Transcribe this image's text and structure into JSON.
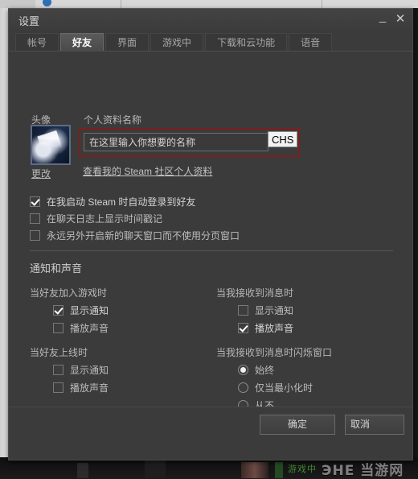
{
  "window": {
    "title": "设置",
    "minimize_label": "_",
    "close_label": "✕"
  },
  "tabs": [
    {
      "label": "帐号",
      "active": false
    },
    {
      "label": "好友",
      "active": true
    },
    {
      "label": "界面",
      "active": false
    },
    {
      "label": "游戏中",
      "active": false
    },
    {
      "label": "下载和云功能",
      "active": false
    },
    {
      "label": "语音",
      "active": false
    }
  ],
  "avatar": {
    "label": "头像",
    "change_label": "更改"
  },
  "profile": {
    "label": "个人资料名称",
    "name_value": "在这里输入你想要的名称",
    "name_placeholder": "在这里输入你想要的名称",
    "ime_indicator": "CHS",
    "link_label": "查看我的 Steam 社区个人资料",
    "highlight_color": "#7d1f1f"
  },
  "general_options": [
    {
      "label": "在我启动 Steam 时自动登录到好友",
      "checked": true
    },
    {
      "label": "在聊天日志上显示时间戳记",
      "checked": false
    },
    {
      "label": "永远另外开启新的聊天窗口而不使用分页窗口",
      "checked": false
    }
  ],
  "notifications": {
    "header": "通知和声音",
    "groups": [
      {
        "title": "当好友加入游戏时",
        "options": [
          {
            "label": "显示通知",
            "checked": true
          },
          {
            "label": "播放声音",
            "checked": false
          }
        ]
      },
      {
        "title": "当我接收到消息时",
        "options": [
          {
            "label": "显示通知",
            "checked": false
          },
          {
            "label": "播放声音",
            "checked": true
          }
        ]
      },
      {
        "title": "当好友上线时",
        "options": [
          {
            "label": "显示通知",
            "checked": false
          },
          {
            "label": "播放声音",
            "checked": false
          }
        ]
      }
    ],
    "flash_group": {
      "title": "当我接收到消息时闪烁窗口",
      "options": [
        {
          "label": "始终",
          "selected": true
        },
        {
          "label": "仅当最小化时",
          "selected": false
        },
        {
          "label": "从不",
          "selected": false
        }
      ]
    }
  },
  "footer": {
    "ok_label": "确定",
    "cancel_label": "取消"
  },
  "watermark": {
    "text": "ЭHE 当游网"
  },
  "background": {
    "green_text": "游戏中"
  }
}
